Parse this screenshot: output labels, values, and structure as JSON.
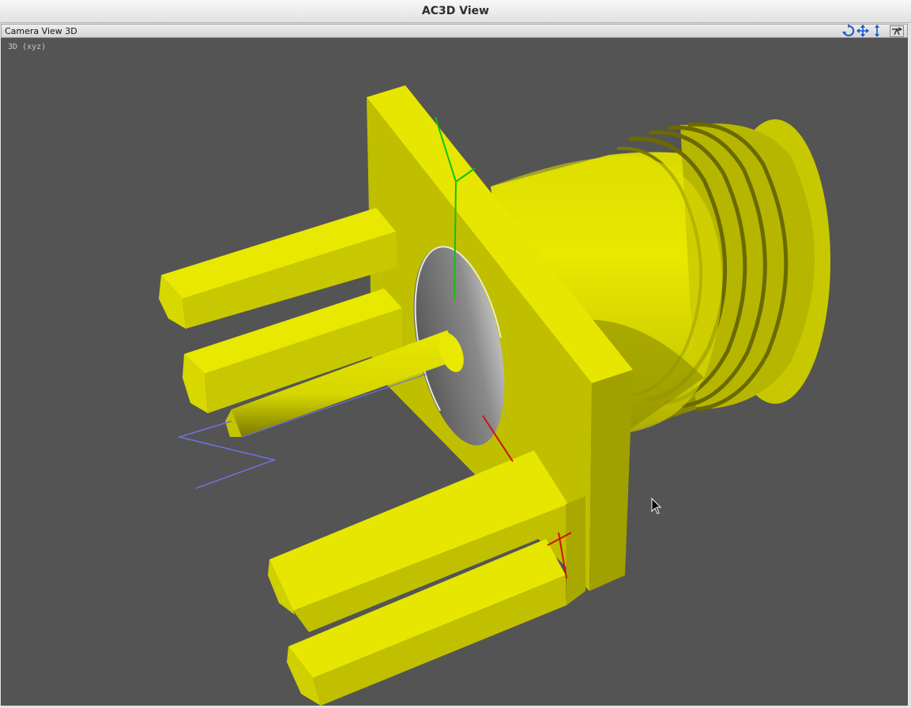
{
  "window": {
    "title": "AC3D View"
  },
  "toolbar": {
    "view_label": "Camera View 3D",
    "tools": [
      {
        "name": "rotate-view",
        "icon": "rotate-arrows-icon"
      },
      {
        "name": "pan-view",
        "icon": "move-arrows-icon"
      },
      {
        "name": "zoom-view",
        "icon": "vertical-arrows-icon"
      },
      {
        "name": "view-options",
        "icon": "camera-options-icon"
      }
    ]
  },
  "viewport": {
    "overlay_label": "3D (xyz)",
    "background_color": "#545454",
    "model_color": "#e6e600",
    "axis_colors": {
      "x": "#d01010",
      "y": "#10c010",
      "z": "#7070e0"
    }
  }
}
